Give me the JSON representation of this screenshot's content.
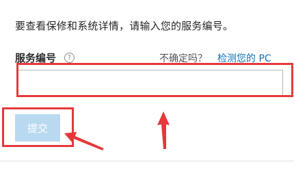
{
  "intro_text": "要查看保修和系统详情，请输入您的服务编号。",
  "form": {
    "field_label": "服务编号",
    "help_icon_glyph": "?",
    "unsure_text": "不确定吗？",
    "detect_link": "检测您的 PC",
    "input_value": "",
    "input_placeholder": "",
    "submit_label": "提交"
  },
  "colors": {
    "annotation_red": "#e5383b",
    "link_blue": "#1470b4",
    "submit_disabled": "#b9d9f0"
  },
  "icons": {
    "help": "question-circle-icon",
    "arrows": "red-arrow-icon"
  }
}
